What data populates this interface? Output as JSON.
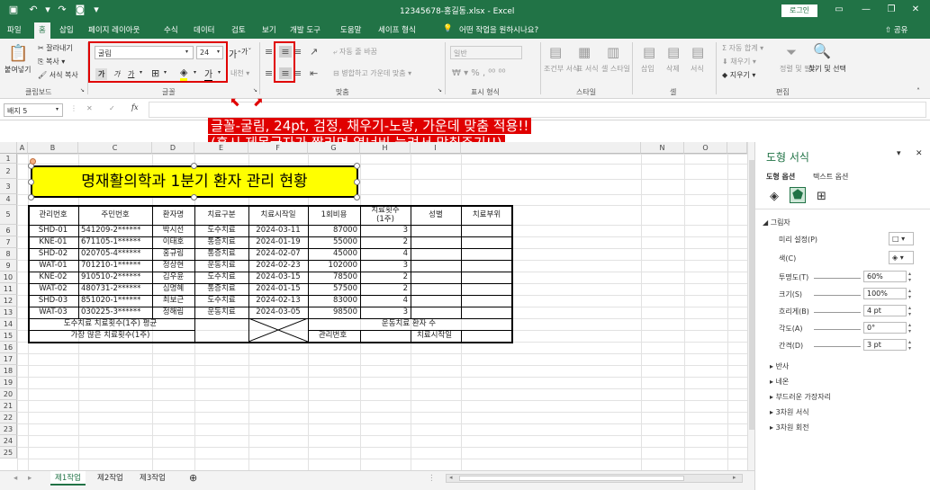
{
  "titlebar": {
    "filename": "12345678-홍길동.xlsx",
    "app": "Excel",
    "login": "로그인",
    "save_icon": "save-icon",
    "undo_icon": "undo-icon",
    "redo_icon": "redo-icon"
  },
  "menu": {
    "tabs": [
      "파일",
      "홈",
      "삽입",
      "페이지 레이아웃",
      "수식",
      "데이터",
      "검토",
      "보기",
      "개발 도구",
      "도움말",
      "세이프 형식"
    ],
    "tell_me": "어떤 작업을 원하시나요?",
    "share": "공유"
  },
  "ribbon": {
    "clipboard": {
      "paste": "붙여넣기",
      "cut": "잘라내기",
      "copy": "복사",
      "format_painter": "서식 복사",
      "label": "클립보드"
    },
    "font": {
      "name": "굴림",
      "size": "24",
      "bold": "가",
      "italic": "가",
      "underline": "가",
      "label": "글꼴"
    },
    "alignment": {
      "wrap": "자동 줄 바꿈",
      "merge": "병합하고 가운데 맞춤",
      "label": "맞춤"
    },
    "number": {
      "format": "일반",
      "label": "표시 형식"
    },
    "styles": {
      "cond": "조건부 서식",
      "table": "표 서식",
      "cell": "셀 스타일",
      "label": "스타일"
    },
    "cells": {
      "insert": "삽입",
      "delete": "삭제",
      "format": "서식",
      "label": "셀"
    },
    "editing": {
      "autosum": "자동 합계",
      "fill": "채우기",
      "clear": "지우기",
      "sort": "정렬 및 필터",
      "find": "찾기 및 선택",
      "label": "편집"
    }
  },
  "formula_bar": {
    "name_box": "배지 5",
    "fx": "fx",
    "cancel": "✕",
    "enter": "✓"
  },
  "annotation": {
    "line1": "글꼴-굴림, 24pt, 검정, 채우기-노랑, 가운데 맞춤 적용!!",
    "line2": "(혹시 제목글자가 짤리면 열너비 늘려서 맞춰주기!!)"
  },
  "columns": [
    "A",
    "B",
    "C",
    "D",
    "E",
    "F",
    "G",
    "H",
    "I",
    "N",
    "O"
  ],
  "rows": [
    "1",
    "2",
    "3",
    "4",
    "5",
    "6",
    "7",
    "8",
    "9",
    "10",
    "11",
    "12",
    "13",
    "14",
    "15",
    "16",
    "17",
    "18",
    "19",
    "20",
    "21",
    "22",
    "23",
    "24",
    "25"
  ],
  "shape_title": "명재활의학과 1분기 환자 관리 현황",
  "table": {
    "headers": [
      "관리번호",
      "주민번호",
      "환자명",
      "치료구분",
      "치료시작일",
      "1회비용",
      "치료횟수\n(1주)",
      "성별",
      "치료부위"
    ],
    "rows": [
      [
        "SHD-01",
        "541209-2******",
        "박시선",
        "도수치료",
        "2024-03-11",
        "87000",
        "3"
      ],
      [
        "KNE-01",
        "671105-1******",
        "이태호",
        "통증치료",
        "2024-01-19",
        "55000",
        "2"
      ],
      [
        "SHD-02",
        "020705-4******",
        "홍규림",
        "통증치료",
        "2024-02-07",
        "45000",
        "4"
      ],
      [
        "WAT-01",
        "701210-1******",
        "정상현",
        "운동치료",
        "2024-02-23",
        "102000",
        "3"
      ],
      [
        "KNE-02",
        "910510-2******",
        "김우윤",
        "도수치료",
        "2024-03-15",
        "78500",
        "2"
      ],
      [
        "WAT-02",
        "480731-2******",
        "심명혜",
        "통증치료",
        "2024-01-15",
        "57500",
        "2"
      ],
      [
        "SHD-03",
        "851020-1******",
        "최보근",
        "도수치료",
        "2024-02-13",
        "83000",
        "4"
      ],
      [
        "WAT-03",
        "030225-3******",
        "정해림",
        "운동치료",
        "2024-03-05",
        "98500",
        "3"
      ]
    ],
    "row13_label": "도수치료 치료횟수(1주) 평균",
    "row14_label": "가장 많은 치료횟수(1주)",
    "row13_right": "운동치료 환자 수",
    "row14_mgmt": "관리번호",
    "row14_start": "치료시작일"
  },
  "pane": {
    "title": "도형 서식",
    "tab_shape": "도형 옵션",
    "tab_text": "텍스트 옵션",
    "section_shadow": "그림자",
    "preset": "미리 설정(P)",
    "color": "색(C)",
    "transparency": "투명도(T)",
    "transparency_val": "60%",
    "size": "크기(S)",
    "size_val": "100%",
    "blur": "흐리게(B)",
    "blur_val": "4 pt",
    "angle": "각도(A)",
    "angle_val": "0°",
    "distance": "간격(D)",
    "distance_val": "3 pt",
    "sections": [
      "반사",
      "네온",
      "부드러운 가장자리",
      "3차원 서식",
      "3차원 회전"
    ]
  },
  "sheets": [
    "제1작업",
    "제2작업",
    "제3작업"
  ],
  "colors": {
    "excel_green": "#217346",
    "annotation_red": "#e00000",
    "shape_fill": "#ffff00"
  }
}
